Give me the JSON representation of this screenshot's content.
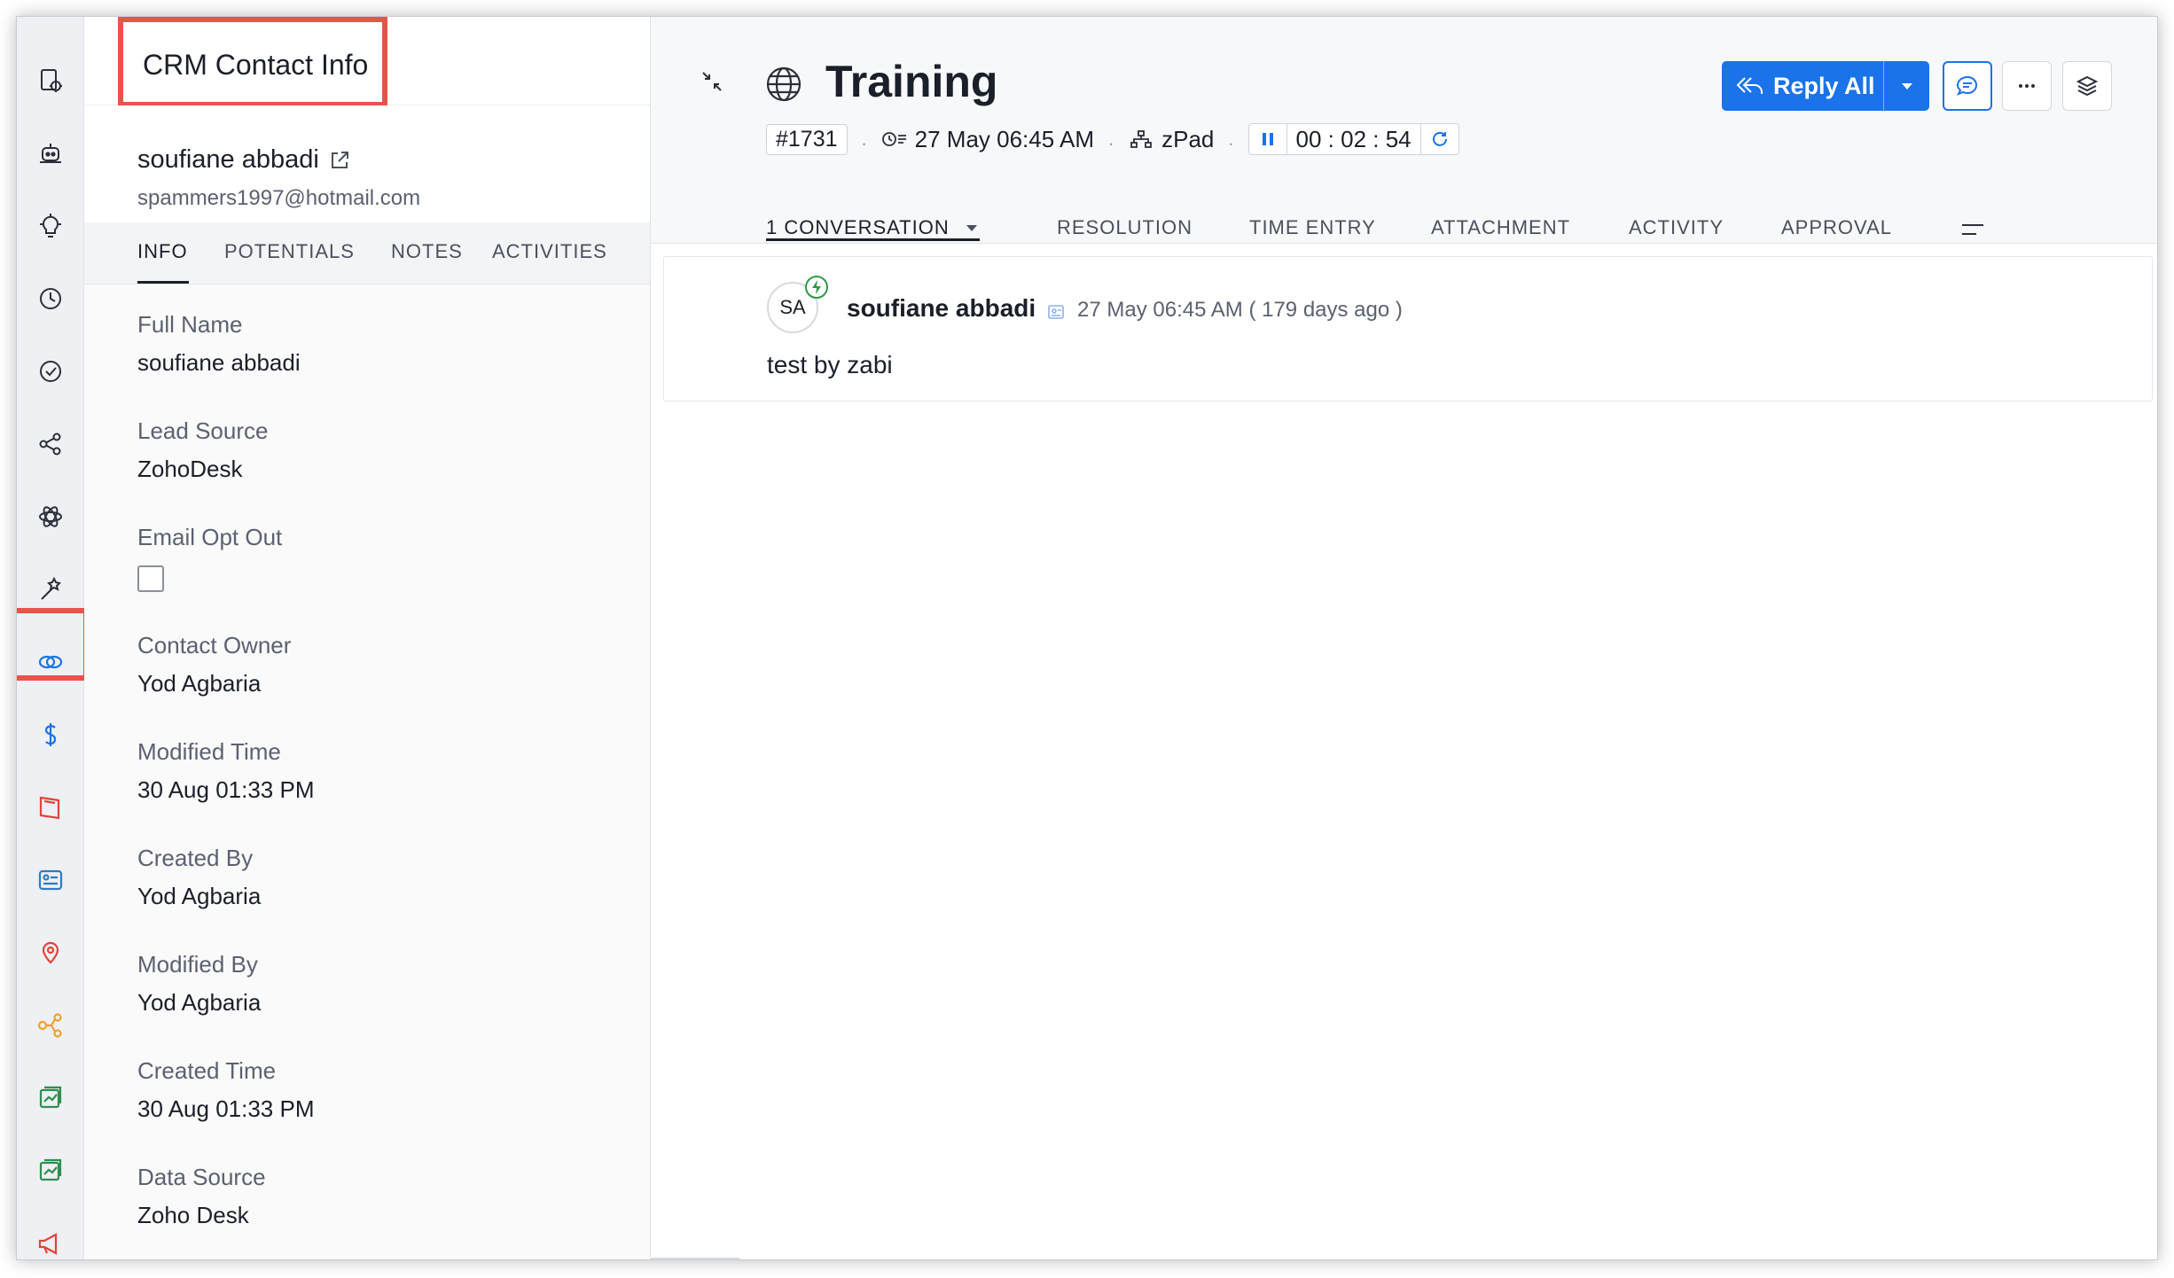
{
  "crm": {
    "title": "CRM Contact Info",
    "contact_name": "soufiane abbadi",
    "contact_email": "spammers1997@hotmail.com",
    "tabs": [
      "INFO",
      "POTENTIALS",
      "NOTES",
      "ACTIVITIES"
    ],
    "fields": [
      {
        "label": "Full Name",
        "value": "soufiane abbadi"
      },
      {
        "label": "Lead Source",
        "value": "ZohoDesk"
      },
      {
        "label": "Email Opt Out",
        "value": ""
      },
      {
        "label": "Contact Owner",
        "value": "Yod Agbaria"
      },
      {
        "label": "Modified Time",
        "value": "30 Aug 01:33 PM"
      },
      {
        "label": "Created By",
        "value": "Yod Agbaria"
      },
      {
        "label": "Modified By",
        "value": "Yod Agbaria"
      },
      {
        "label": "Created Time",
        "value": "30 Aug 01:33 PM"
      },
      {
        "label": "Data Source",
        "value": "Zoho Desk"
      }
    ]
  },
  "rail": {
    "icons": [
      "gear-doc-icon",
      "bot-icon",
      "bulb-icon",
      "history-icon",
      "check-circle-icon",
      "share-icon",
      "atom-icon",
      "magic-wand-icon",
      "crm-link-icon",
      "zoho-s-icon",
      "book-icon",
      "settings-card-icon",
      "map-pin-icon",
      "flow-icon",
      "chart-doc-icon",
      "chart-doc-icon-2",
      "megaphone-icon"
    ],
    "active": "crm-link-icon"
  },
  "ticket": {
    "title": "Training",
    "id": "#1731",
    "due": "27 May 06:45 AM",
    "department": "zPad",
    "timer": "00 : 02 : 54"
  },
  "toolbar": {
    "reply_all": "Reply All"
  },
  "tabs": {
    "conversation": "1 CONVERSATION",
    "resolution": "RESOLUTION",
    "time_entry": "TIME ENTRY",
    "attachment": "ATTACHMENT",
    "activity": "ACTIVITY",
    "approval": "APPROVAL"
  },
  "thread": {
    "initials": "SA",
    "author": "soufiane abbadi",
    "time": "27 May 06:45 AM ( 179 days ago )",
    "body": "test by zabi"
  },
  "colors": {
    "accent": "#1a73e8",
    "highlight": "#e8534a"
  }
}
